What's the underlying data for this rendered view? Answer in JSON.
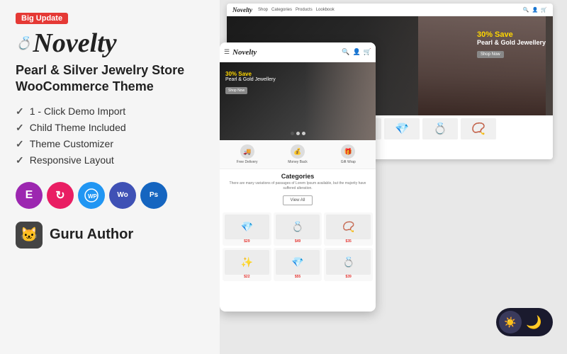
{
  "badge": {
    "text": "Big Update"
  },
  "logo": {
    "text": "Novelty",
    "ring_icon": "💍"
  },
  "subtitle": {
    "line1": "Pearl & Silver Jewelry Store",
    "line2": "WooCommerce Theme"
  },
  "features": [
    "1 - Click Demo Import",
    "Child Theme Included",
    "Theme Customizer",
    "Responsive Layout"
  ],
  "tech_icons": [
    {
      "label": "E",
      "title": "Elementor",
      "class": "tech-icon-e"
    },
    {
      "label": "↻",
      "title": "Revolution Slider",
      "class": "tech-icon-c"
    },
    {
      "label": "W",
      "title": "WordPress",
      "class": "tech-icon-wp"
    },
    {
      "label": "Wo",
      "title": "WooCommerce",
      "class": "tech-icon-wo"
    },
    {
      "label": "Ps",
      "title": "Photoshop",
      "class": "tech-icon-ps"
    }
  ],
  "guru": {
    "label": "Guru Author",
    "icon": "🐱"
  },
  "desktop_mockup": {
    "nav_logo": "Novelty",
    "hero": {
      "save_text": "30% Save",
      "title": "Pearl & Gold Jewellery",
      "btn": "Shop Now"
    }
  },
  "mobile_mockup": {
    "logo": "Novelty",
    "hero": {
      "save": "30% Save",
      "title": "Pearl & Gold Jewellery",
      "btn": "Shop Now"
    },
    "features": [
      {
        "icon": "🚚",
        "label": "Free Delivery"
      },
      {
        "icon": "💰",
        "label": "Money Back"
      },
      {
        "icon": "🎁",
        "label": "Gift Wrap"
      }
    ],
    "categories_title": "Categories",
    "categories_desc": "There are many variations of passages of Lorem Ipsum available, but the majority have suffered alteration.",
    "view_all_btn": "View All",
    "products": [
      {
        "emoji": "💎"
      },
      {
        "emoji": "💍"
      },
      {
        "emoji": "📿"
      },
      {
        "emoji": "✨"
      },
      {
        "emoji": "💎"
      },
      {
        "emoji": "💍"
      }
    ]
  },
  "dark_toggle": {
    "moon": "🌙"
  },
  "colors": {
    "accent_red": "#e53935",
    "dark_bg": "#1a1a2e"
  }
}
